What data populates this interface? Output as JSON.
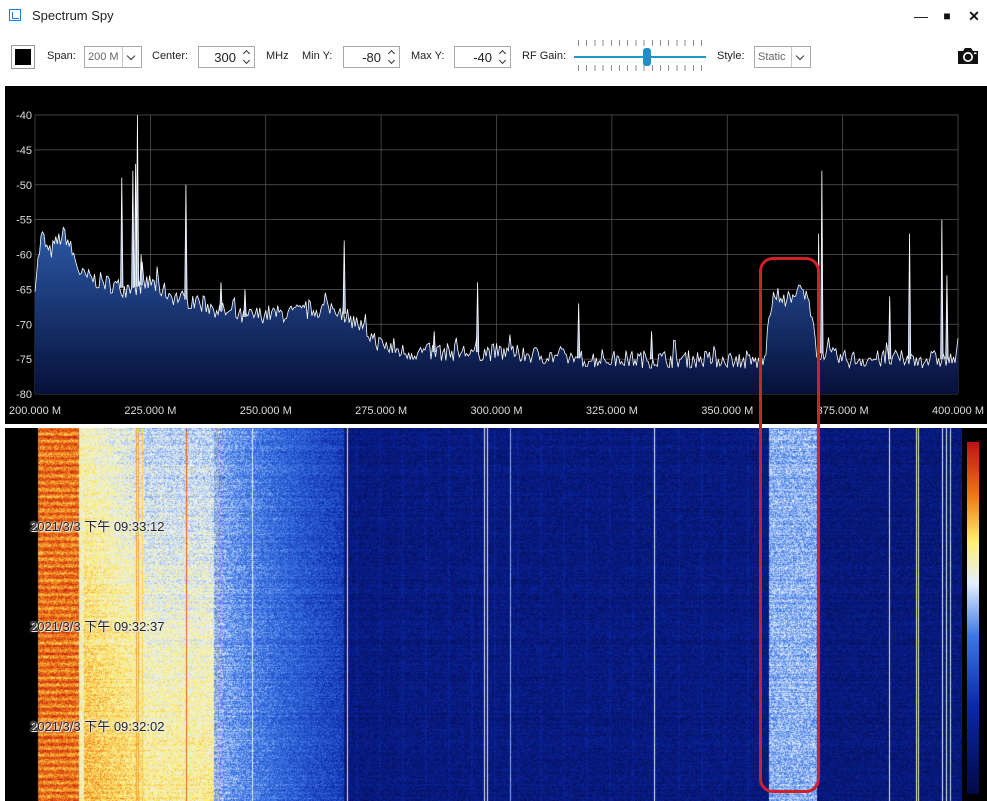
{
  "window": {
    "title": "Spectrum Spy",
    "minimize": "—",
    "maximize": "■",
    "close": "✕"
  },
  "toolbar": {
    "span_label": "Span:",
    "span_value": "200 M",
    "center_label": "Center:",
    "center_value": "300",
    "center_unit": "MHz",
    "miny_label": "Min Y:",
    "miny_value": "-80",
    "maxy_label": "Max Y:",
    "maxy_value": "-40",
    "rfgain_label": "RF Gain:",
    "rfgain_level": 0.56,
    "style_label": "Style:",
    "style_value": "Static"
  },
  "chart_data": {
    "type": "line",
    "xlim": [
      200,
      400
    ],
    "ylim": [
      -80,
      -40
    ],
    "x_ticks": [
      200,
      225,
      250,
      275,
      300,
      325,
      350,
      375,
      400
    ],
    "x_tick_labels": [
      "200.000 M",
      "225.000 M",
      "250.000 M",
      "275.000 M",
      "300.000 M",
      "325.000 M",
      "350.000 M",
      "375.000 M",
      "400.000 M"
    ],
    "y_ticks": [
      -40,
      -45,
      -50,
      -55,
      -60,
      -65,
      -70,
      -75,
      -80
    ],
    "y_tick_labels": [
      "-40",
      "-45",
      "-50",
      "-55",
      "-60",
      "-65",
      "-70",
      "-75",
      "-80"
    ],
    "grid": true,
    "line_color": "#ffffff",
    "fill_top": "#2c5aa8",
    "fill_bottom": "#06103a",
    "peaks": [
      {
        "x": 218.8,
        "y": -49
      },
      {
        "x": 221.2,
        "y": -48
      },
      {
        "x": 221.8,
        "y": -47
      },
      {
        "x": 222.2,
        "y": -40
      },
      {
        "x": 223.0,
        "y": -60
      },
      {
        "x": 232.7,
        "y": -50
      },
      {
        "x": 240.3,
        "y": -64
      },
      {
        "x": 245.5,
        "y": -65
      },
      {
        "x": 267.0,
        "y": -58
      },
      {
        "x": 286.5,
        "y": -71
      },
      {
        "x": 295.9,
        "y": -64
      },
      {
        "x": 317.8,
        "y": -67
      },
      {
        "x": 333.6,
        "y": -71
      },
      {
        "x": 370.5,
        "y": -48
      },
      {
        "x": 369.8,
        "y": -57
      },
      {
        "x": 385.2,
        "y": -66
      },
      {
        "x": 389.5,
        "y": -57
      },
      {
        "x": 396.5,
        "y": -55
      },
      {
        "x": 397.6,
        "y": -63
      }
    ],
    "baseline": [
      [
        200,
        -64
      ],
      [
        201.5,
        -57
      ],
      [
        203,
        -60
      ],
      [
        205,
        -58
      ],
      [
        206.5,
        -57
      ],
      [
        210,
        -63
      ],
      [
        215,
        -64
      ],
      [
        220,
        -65
      ],
      [
        225,
        -64
      ],
      [
        230,
        -66
      ],
      [
        236,
        -67
      ],
      [
        240,
        -68
      ],
      [
        245,
        -69
      ],
      [
        250,
        -68.5
      ],
      [
        255,
        -68.5
      ],
      [
        260,
        -68
      ],
      [
        265,
        -67.5
      ],
      [
        270,
        -70
      ],
      [
        275,
        -73
      ],
      [
        280,
        -74
      ],
      [
        290,
        -74
      ],
      [
        300,
        -74
      ],
      [
        310,
        -74.5
      ],
      [
        320,
        -75
      ],
      [
        330,
        -75
      ],
      [
        340,
        -75
      ],
      [
        350,
        -75
      ],
      [
        358,
        -75.5
      ],
      [
        359.5,
        -67
      ],
      [
        361,
        -66
      ],
      [
        364,
        -66.5
      ],
      [
        366,
        -65
      ],
      [
        368,
        -67.5
      ],
      [
        369.5,
        -74
      ],
      [
        375,
        -75
      ],
      [
        385,
        -75
      ],
      [
        395,
        -75
      ],
      [
        400,
        -75
      ]
    ]
  },
  "waterfall": {
    "timestamps": [
      "2021/3/3 下午 09:33:12",
      "2021/3/3 下午 09:32:37",
      "2021/3/3 下午 09:32:02"
    ]
  }
}
